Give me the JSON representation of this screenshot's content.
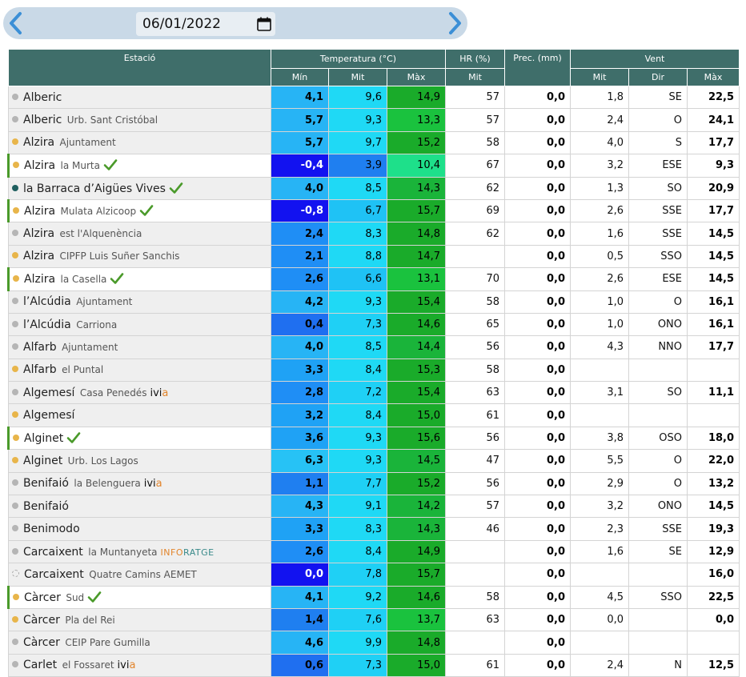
{
  "date": {
    "value": "06/01/2022"
  },
  "icons": {
    "prev": "chevron-left-icon",
    "next": "chevron-right-icon",
    "calendar": "calendar-icon",
    "check": "check-icon"
  },
  "colors": {
    "header_bg": "#3f6e6a",
    "dot_orange": "#e8b54a",
    "dot_grey": "#b5b5b5",
    "dot_teal": "#1f5f5f",
    "tmax": "#1aab2a",
    "tmax_light": "#1ed46a",
    "tmit_cyan": "#1fd9f5",
    "tmin_blue": "#27b4f5",
    "tmin_dark": "#1f6ff0",
    "tmin_navy": "#1212f0"
  },
  "header": {
    "estacio": "Estació",
    "temperatura": "Temperatura (°C)",
    "hr": "HR (%)",
    "prec": "Prec. (mm)",
    "vent": "Vent",
    "t_min": "Mín",
    "t_mit": "Mit",
    "t_max": "Màx",
    "hr_mit": "Mit",
    "v_mit": "Mit",
    "v_dir": "Dir",
    "v_max": "Màx"
  },
  "rows": [
    {
      "name": "Alberic",
      "sub": "",
      "dot": "grey",
      "hl": false,
      "check": false,
      "tag": "",
      "tmin": "4,1",
      "tmit": "9,6",
      "tmax": "14,9",
      "hr": "57",
      "prec": "0,0",
      "vmit": "1,8",
      "vdir": "SE",
      "vmax": "22,5",
      "cmin": "#27b4f5",
      "cmit": "#1fd9f5",
      "cmax": "#1aab2a"
    },
    {
      "name": "Alberic",
      "sub": "Urb. Sant Cristóbal",
      "dot": "grey",
      "hl": false,
      "check": false,
      "tag": "",
      "tmin": "5,7",
      "tmit": "9,3",
      "tmax": "13,3",
      "hr": "57",
      "prec": "0,0",
      "vmit": "2,4",
      "vdir": "O",
      "vmax": "24,1",
      "cmin": "#27b4f5",
      "cmit": "#1fd9f5",
      "cmax": "#1ac23e"
    },
    {
      "name": "Alzira",
      "sub": "Ajuntament",
      "dot": "orange",
      "hl": false,
      "check": false,
      "tag": "",
      "tmin": "5,7",
      "tmit": "9,7",
      "tmax": "15,2",
      "hr": "58",
      "prec": "0,0",
      "vmit": "4,0",
      "vdir": "S",
      "vmax": "17,7",
      "cmin": "#27b4f5",
      "cmit": "#1fd9f5",
      "cmax": "#1aab2a"
    },
    {
      "name": "Alzira",
      "sub": "la Murta",
      "dot": "orange",
      "hl": true,
      "check": true,
      "tag": "",
      "tmin": "-0,4",
      "tmit": "3,9",
      "tmax": "10,4",
      "hr": "67",
      "prec": "0,0",
      "vmit": "3,2",
      "vdir": "ESE",
      "vmax": "9,3",
      "cmin": "#1212f0",
      "cmit": "#1f7ff0",
      "cmax": "#1ee08a"
    },
    {
      "name": "la Barraca d’Aigües Vives",
      "sub": "",
      "dot": "teal",
      "hl": false,
      "check": true,
      "tag": "",
      "tmin": "4,0",
      "tmit": "8,5",
      "tmax": "14,3",
      "hr": "62",
      "prec": "0,0",
      "vmit": "1,3",
      "vdir": "SO",
      "vmax": "20,9",
      "cmin": "#27b4f5",
      "cmit": "#1fd9f5",
      "cmax": "#1ab43a"
    },
    {
      "name": "Alzira",
      "sub": "Mulata Alzicoop",
      "dot": "orange",
      "hl": true,
      "check": true,
      "tag": "",
      "tmin": "-0,8",
      "tmit": "6,7",
      "tmax": "15,7",
      "hr": "69",
      "prec": "0,0",
      "vmit": "2,6",
      "vdir": "SSE",
      "vmax": "17,7",
      "cmin": "#1212f0",
      "cmit": "#1fc2f5",
      "cmax": "#1aab2a"
    },
    {
      "name": "Alzira",
      "sub": "est l'Alquenència",
      "dot": "grey",
      "hl": false,
      "check": false,
      "tag": "",
      "tmin": "2,4",
      "tmit": "8,3",
      "tmax": "14,8",
      "hr": "62",
      "prec": "0,0",
      "vmit": "1,6",
      "vdir": "SSE",
      "vmax": "14,5",
      "cmin": "#1f8ef5",
      "cmit": "#1fd9f5",
      "cmax": "#1aab2a"
    },
    {
      "name": "Alzira",
      "sub": "CIPFP Luis Suñer Sanchis",
      "dot": "orange",
      "hl": false,
      "check": false,
      "tag": "",
      "tmin": "2,1",
      "tmit": "8,8",
      "tmax": "14,7",
      "hr": "",
      "prec": "0,0",
      "vmit": "0,5",
      "vdir": "SSO",
      "vmax": "14,5",
      "cmin": "#1f8ef5",
      "cmit": "#1fd9f5",
      "cmax": "#1aab2a"
    },
    {
      "name": "Alzira",
      "sub": "la Casella",
      "dot": "orange",
      "hl": true,
      "check": true,
      "tag": "",
      "tmin": "2,6",
      "tmit": "6,6",
      "tmax": "13,1",
      "hr": "70",
      "prec": "0,0",
      "vmit": "2,6",
      "vdir": "ESE",
      "vmax": "14,5",
      "cmin": "#1f8ef5",
      "cmit": "#1fc2f5",
      "cmax": "#1ac23e"
    },
    {
      "name": "l’Alcúdia",
      "sub": "Ajuntament",
      "dot": "grey",
      "hl": false,
      "check": false,
      "tag": "",
      "tmin": "4,2",
      "tmit": "9,3",
      "tmax": "15,4",
      "hr": "58",
      "prec": "0,0",
      "vmit": "1,0",
      "vdir": "O",
      "vmax": "16,1",
      "cmin": "#27b4f5",
      "cmit": "#1fd9f5",
      "cmax": "#1aab2a"
    },
    {
      "name": "l’Alcúdia",
      "sub": "Carriona",
      "dot": "grey",
      "hl": false,
      "check": false,
      "tag": "",
      "tmin": "0,4",
      "tmit": "7,3",
      "tmax": "14,6",
      "hr": "65",
      "prec": "0,0",
      "vmit": "1,0",
      "vdir": "ONO",
      "vmax": "16,1",
      "cmin": "#1f6ff0",
      "cmit": "#1fd0f5",
      "cmax": "#1aab2a"
    },
    {
      "name": "Alfarb",
      "sub": "Ajuntament",
      "dot": "grey",
      "hl": false,
      "check": false,
      "tag": "",
      "tmin": "4,0",
      "tmit": "8,5",
      "tmax": "14,4",
      "hr": "56",
      "prec": "0,0",
      "vmit": "4,3",
      "vdir": "NNO",
      "vmax": "17,7",
      "cmin": "#27b4f5",
      "cmit": "#1fd9f5",
      "cmax": "#1ab43a"
    },
    {
      "name": "Alfarb",
      "sub": "el Puntal",
      "dot": "orange",
      "hl": false,
      "check": false,
      "tag": "",
      "tmin": "3,3",
      "tmit": "8,4",
      "tmax": "15,3",
      "hr": "58",
      "prec": "0,0",
      "vmit": "",
      "vdir": "",
      "vmax": "",
      "cmin": "#1fa2f5",
      "cmit": "#1fd9f5",
      "cmax": "#1aab2a"
    },
    {
      "name": "Algemesí",
      "sub": "Casa Penedés",
      "dot": "grey",
      "hl": false,
      "check": false,
      "tag": "ivia",
      "tmin": "2,8",
      "tmit": "7,2",
      "tmax": "15,4",
      "hr": "63",
      "prec": "0,0",
      "vmit": "3,1",
      "vdir": "SO",
      "vmax": "11,1",
      "cmin": "#1f8ef5",
      "cmit": "#1fd0f5",
      "cmax": "#1aab2a"
    },
    {
      "name": "Algemesí",
      "sub": "",
      "dot": "orange",
      "hl": false,
      "check": false,
      "tag": "",
      "tmin": "3,2",
      "tmit": "8,4",
      "tmax": "15,0",
      "hr": "61",
      "prec": "0,0",
      "vmit": "",
      "vdir": "",
      "vmax": "",
      "cmin": "#1fa2f5",
      "cmit": "#1fd9f5",
      "cmax": "#1aab2a"
    },
    {
      "name": "Alginet",
      "sub": "",
      "dot": "orange",
      "hl": true,
      "check": true,
      "tag": "",
      "tmin": "3,6",
      "tmit": "9,3",
      "tmax": "15,6",
      "hr": "56",
      "prec": "0,0",
      "vmit": "3,8",
      "vdir": "OSO",
      "vmax": "18,0",
      "cmin": "#1fa2f5",
      "cmit": "#1fd9f5",
      "cmax": "#1aab2a"
    },
    {
      "name": "Alginet",
      "sub": "Urb. Los Lagos",
      "dot": "orange",
      "hl": false,
      "check": false,
      "tag": "",
      "tmin": "6,3",
      "tmit": "9,3",
      "tmax": "14,5",
      "hr": "47",
      "prec": "0,0",
      "vmit": "5,5",
      "vdir": "O",
      "vmax": "22,0",
      "cmin": "#27c2f5",
      "cmit": "#1fd9f5",
      "cmax": "#1ab43a"
    },
    {
      "name": "Benifaió",
      "sub": "la Belenguera",
      "dot": "grey",
      "hl": false,
      "check": false,
      "tag": "ivia",
      "tmin": "1,1",
      "tmit": "7,7",
      "tmax": "15,2",
      "hr": "56",
      "prec": "0,0",
      "vmit": "2,9",
      "vdir": "O",
      "vmax": "13,2",
      "cmin": "#1f7ff0",
      "cmit": "#1fd0f5",
      "cmax": "#1aab2a"
    },
    {
      "name": "Benifaió",
      "sub": "",
      "dot": "grey",
      "hl": false,
      "check": false,
      "tag": "",
      "tmin": "4,3",
      "tmit": "9,1",
      "tmax": "14,2",
      "hr": "57",
      "prec": "0,0",
      "vmit": "3,2",
      "vdir": "ONO",
      "vmax": "14,5",
      "cmin": "#27b4f5",
      "cmit": "#1fd9f5",
      "cmax": "#1ab43a"
    },
    {
      "name": "Benimodo",
      "sub": "",
      "dot": "grey",
      "hl": false,
      "check": false,
      "tag": "",
      "tmin": "3,3",
      "tmit": "8,3",
      "tmax": "14,3",
      "hr": "46",
      "prec": "0,0",
      "vmit": "2,3",
      "vdir": "SSE",
      "vmax": "19,3",
      "cmin": "#1fa2f5",
      "cmit": "#1fd9f5",
      "cmax": "#1ab43a"
    },
    {
      "name": "Carcaixent",
      "sub": "la Muntanyeta",
      "dot": "grey",
      "hl": false,
      "check": false,
      "tag": "infor",
      "tmin": "2,6",
      "tmit": "8,4",
      "tmax": "14,9",
      "hr": "",
      "prec": "0,0",
      "vmit": "1,6",
      "vdir": "SE",
      "vmax": "12,9",
      "cmin": "#1f8ef5",
      "cmit": "#1fd9f5",
      "cmax": "#1aab2a"
    },
    {
      "name": "Carcaixent",
      "sub": "Quatre Camins AEMET",
      "dot": "hollow",
      "hl": false,
      "check": false,
      "tag": "",
      "tmin": "0,0",
      "tmit": "7,8",
      "tmax": "15,7",
      "hr": "",
      "prec": "0,0",
      "vmit": "",
      "vdir": "",
      "vmax": "16,0",
      "cmin": "#1212f0",
      "cmit": "#1fd0f5",
      "cmax": "#1aab2a"
    },
    {
      "name": "Càrcer",
      "sub": "Sud",
      "dot": "orange",
      "hl": true,
      "check": true,
      "tag": "",
      "tmin": "4,1",
      "tmit": "9,2",
      "tmax": "14,6",
      "hr": "58",
      "prec": "0,0",
      "vmit": "4,5",
      "vdir": "SSO",
      "vmax": "22,5",
      "cmin": "#27b4f5",
      "cmit": "#1fd9f5",
      "cmax": "#1aab2a"
    },
    {
      "name": "Càrcer",
      "sub": "Pla del Rei",
      "dot": "orange",
      "hl": false,
      "check": false,
      "tag": "",
      "tmin": "1,4",
      "tmit": "7,6",
      "tmax": "13,7",
      "hr": "63",
      "prec": "0,0",
      "vmit": "0,0",
      "vdir": "",
      "vmax": "0,0",
      "cmin": "#1f7ff0",
      "cmit": "#1fd0f5",
      "cmax": "#1ac23e"
    },
    {
      "name": "Càrcer",
      "sub": "CEIP Pare Gumilla",
      "dot": "grey",
      "hl": false,
      "check": false,
      "tag": "",
      "tmin": "4,6",
      "tmit": "9,9",
      "tmax": "14,8",
      "hr": "",
      "prec": "0,0",
      "vmit": "",
      "vdir": "",
      "vmax": "",
      "cmin": "#27b4f5",
      "cmit": "#1fd9f5",
      "cmax": "#1aab2a"
    },
    {
      "name": "Carlet",
      "sub": "el Fossaret",
      "dot": "grey",
      "hl": false,
      "check": false,
      "tag": "ivia",
      "tmin": "0,6",
      "tmit": "7,3",
      "tmax": "15,0",
      "hr": "61",
      "prec": "0,0",
      "vmit": "2,4",
      "vdir": "N",
      "vmax": "12,5",
      "cmin": "#1f6ff0",
      "cmit": "#1fd0f5",
      "cmax": "#1aab2a"
    }
  ]
}
